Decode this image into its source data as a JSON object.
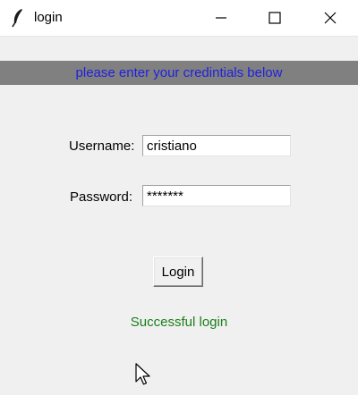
{
  "window": {
    "title": "login",
    "icon": "feather-icon",
    "controls": [
      "minimize-icon",
      "maximize-icon",
      "close-icon"
    ]
  },
  "banner": {
    "text": "please enter your credintials below",
    "background": "#808080",
    "text_color": "#1f1fe0"
  },
  "form": {
    "username_label": "Username:",
    "username_value": "cristiano",
    "password_label": "Password:",
    "password_value": "*******",
    "login_label": "Login"
  },
  "status": {
    "text": "Successful login",
    "color": "#1a7f1a"
  },
  "cursor": "mouse-pointer-icon"
}
